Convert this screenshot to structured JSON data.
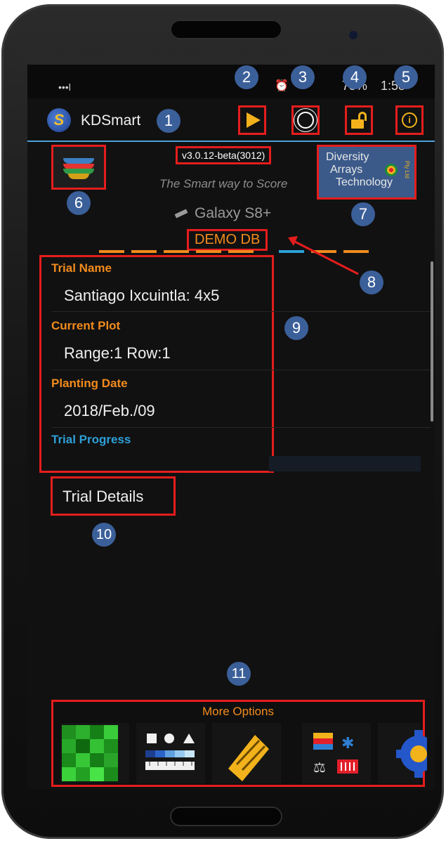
{
  "app": {
    "title": "KDSmart",
    "logo_letter": "S"
  },
  "status": {
    "signal": "•••l",
    "battery": "78%",
    "clock": "1:58",
    "alarm": "⏰"
  },
  "toolbar": {
    "play": "play-icon",
    "brightness": "brightness-icon",
    "lock": "unlock-icon",
    "info": "i"
  },
  "version": "v3.0.12-beta(3012)",
  "tagline": "The Smart way to Score",
  "device": "Galaxy S8+",
  "company_logo": {
    "line1": "Diversity",
    "line2": "Arrays",
    "line3": "Technology",
    "ptyltd": "Pty Ltd"
  },
  "database": "DEMO DB",
  "trial": {
    "name_label": "Trial Name",
    "name": "Santiago Ixcuintla: 4x5",
    "plot_label": "Current Plot",
    "plot": "Range:1 Row:1",
    "date_label": "Planting Date",
    "date": "2018/Feb./09",
    "progress_label": "Trial Progress"
  },
  "details_button": "Trial Details",
  "more_options": {
    "label": "More Options",
    "items": [
      "heatmap-icon",
      "shapes-icon",
      "edit-icon",
      "tools-icon",
      "settings-icon"
    ]
  },
  "callouts": [
    "1",
    "2",
    "3",
    "4",
    "5",
    "6",
    "7",
    "8",
    "9",
    "10",
    "11"
  ],
  "colors": {
    "accent": "#4aa3d6",
    "orange": "#f28b1d",
    "yellow": "#f2b21b",
    "highlight": "#e51d1d",
    "callout": "#3b5f99"
  }
}
